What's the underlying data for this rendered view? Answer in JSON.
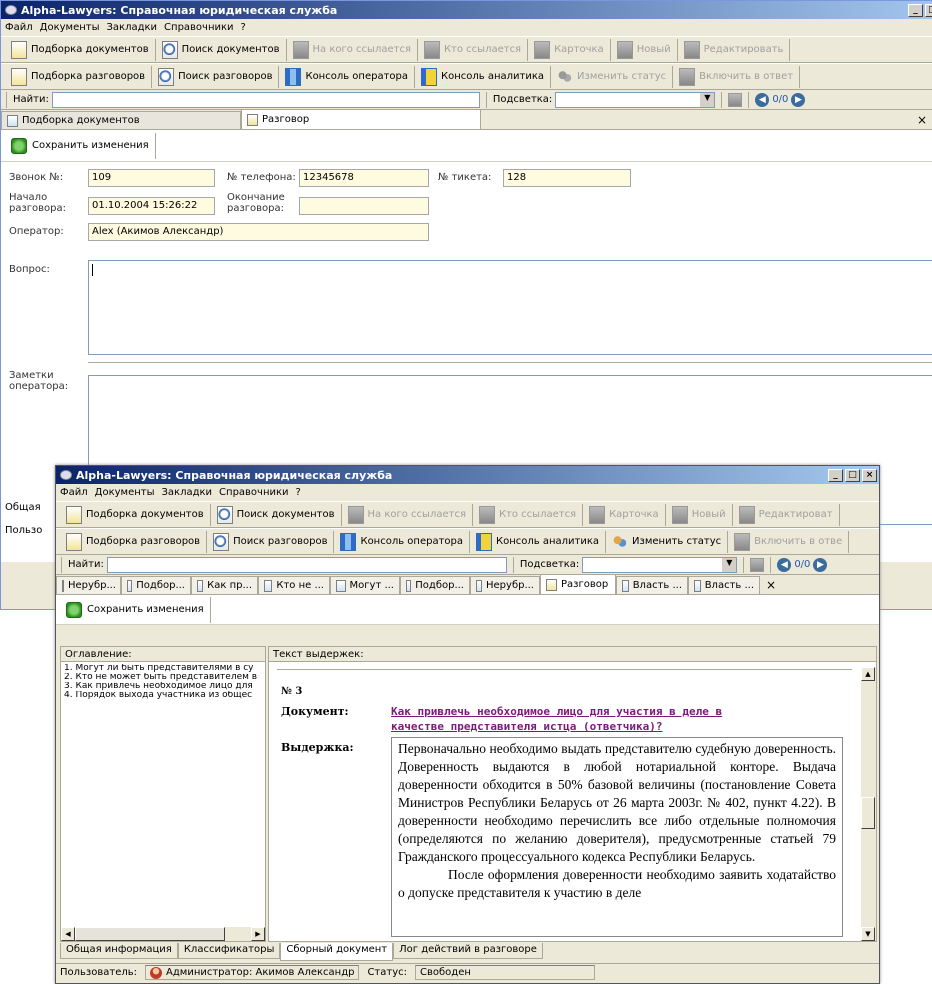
{
  "back_window": {
    "title": "Alpha-Lawyers: Справочная юридическая служба",
    "menu": [
      "Файл",
      "Документы",
      "Закладки",
      "Справочники",
      "?"
    ],
    "toolbar1": [
      {
        "label": "Подборка документов",
        "enabled": true
      },
      {
        "label": "Поиск документов",
        "enabled": true
      },
      {
        "label": "На кого ссылается",
        "enabled": false
      },
      {
        "label": "Кто ссылается",
        "enabled": false
      },
      {
        "label": "Карточка",
        "enabled": false
      },
      {
        "label": "Новый",
        "enabled": false
      },
      {
        "label": "Редактировать",
        "enabled": false
      }
    ],
    "toolbar2": [
      {
        "label": "Подборка разговоров",
        "enabled": true
      },
      {
        "label": "Поиск разговоров",
        "enabled": true
      },
      {
        "label": "Консоль оператора",
        "enabled": true
      },
      {
        "label": "Консоль аналитика",
        "enabled": true
      },
      {
        "label": "Изменить статус",
        "enabled": false
      },
      {
        "label": "Включить в ответ",
        "enabled": false
      }
    ],
    "find_label": "Найти:",
    "highlight_label": "Подсветка:",
    "counter": "0/0",
    "tabs": [
      "Подборка документов",
      "Разговор"
    ],
    "save_label": "Сохранить изменения",
    "form": {
      "call_no_label": "Звонок №:",
      "call_no": "109",
      "phone_label": "№ телефона:",
      "phone": "12345678",
      "ticket_label": "№ тикета:",
      "ticket": "128",
      "start_label_1": "Начало",
      "start_label_2": "разговора:",
      "start": "01.10.2004 15:26:22",
      "end_label_1": "Окончание",
      "end_label_2": "разговора:",
      "end": "",
      "operator_label": "Оператор:",
      "operator": "Alex (Акимов Александр)",
      "question_label": "Вопрос:",
      "notes_label_1": "Заметки",
      "notes_label_2": "оператора:"
    },
    "peek_general": "Общая",
    "peek_user": "Пользо"
  },
  "front_window": {
    "title": "Alpha-Lawyers: Справочная юридическая служба",
    "menu": [
      "Файл",
      "Документы",
      "Закладки",
      "Справочники",
      "?"
    ],
    "toolbar1": [
      {
        "label": "Подборка документов",
        "enabled": true
      },
      {
        "label": "Поиск документов",
        "enabled": true
      },
      {
        "label": "На кого ссылается",
        "enabled": false
      },
      {
        "label": "Кто ссылается",
        "enabled": false
      },
      {
        "label": "Карточка",
        "enabled": false
      },
      {
        "label": "Новый",
        "enabled": false
      },
      {
        "label": "Редактироват",
        "enabled": false
      }
    ],
    "toolbar2": [
      {
        "label": "Подборка разговоров",
        "enabled": true
      },
      {
        "label": "Поиск разговоров",
        "enabled": true
      },
      {
        "label": "Консоль оператора",
        "enabled": true
      },
      {
        "label": "Консоль аналитика",
        "enabled": true
      },
      {
        "label": "Изменить статус",
        "enabled": true
      },
      {
        "label": "Включить в отве",
        "enabled": false
      }
    ],
    "find_label": "Найти:",
    "highlight_label": "Подсветка:",
    "counter": "0/0",
    "tabs": [
      "Нерубр...",
      "Подбор...",
      "Как пр...",
      "Кто не ...",
      "Могут ...",
      "Подбор...",
      "Нерубр...",
      "Разговор",
      "Власть ...",
      "Власть ..."
    ],
    "active_tab": 7,
    "save_label": "Сохранить изменения",
    "toc_header": "Оглавление:",
    "toc": [
      "1. Могут ли быть представителями в су",
      "2. Кто не может быть представителем в",
      "3. Как привлечь необходимое лицо для",
      "4. Порядок выхода участника из общес"
    ],
    "text_header": "Текст выдержек:",
    "item_no": "№ 3",
    "doc_label": "Документ:",
    "doc_link_1": "Как привлечь необходимое лицо для участия в деле в",
    "doc_link_2": "качестве представителя истца (ответчика)?",
    "excerpt_label": "Выдержка:",
    "excerpt_p1": "Первоначально необходимо выдать представителю судебную доверенность. Доверенность выдаются в любой нотариальной конторе. Выдача доверенности обходится в 50% базовой величины (постановление Совета Министров Республики Беларусь от 26 марта 2003г. № 402, пункт 4.22). В доверенности необходимо перечислить все либо отдельные полномочия (определяются по желанию доверителя), предусмотренные статьей 79 Гражданского процессуального кодекса Республики Беларусь.",
    "excerpt_p2": "После оформления доверенности необходимо заявить ходатайство о допуске представителя к участию в деле",
    "bottom_tabs": [
      "Общая информация",
      "Классификаторы",
      "Сборный документ",
      "Лог действий в разговоре"
    ],
    "active_bottom_tab": 2,
    "status_user_label": "Пользователь:",
    "status_user": "Администратор: Акимов Александр",
    "status_label": "Статус:",
    "status_value": "Свободен"
  }
}
